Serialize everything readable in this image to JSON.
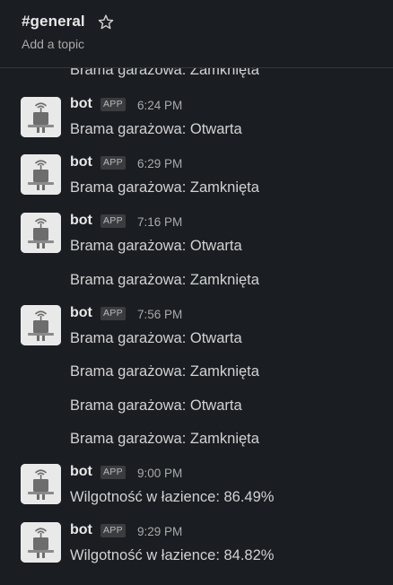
{
  "channel": {
    "name": "#general",
    "topic_placeholder": "Add a topic",
    "star_icon": "star-outline-icon"
  },
  "cut_off_text": "Brama garażowa: Zamknięta",
  "messages": [
    {
      "author": "bot",
      "badge": "APP",
      "time": "6:24 PM",
      "lines": [
        "Brama garażowa: Otwarta"
      ]
    },
    {
      "author": "bot",
      "badge": "APP",
      "time": "6:29 PM",
      "lines": [
        "Brama garażowa: Zamknięta"
      ]
    },
    {
      "author": "bot",
      "badge": "APP",
      "time": "7:16 PM",
      "lines": [
        "Brama garażowa: Otwarta",
        "Brama garażowa: Zamknięta"
      ]
    },
    {
      "author": "bot",
      "badge": "APP",
      "time": "7:56 PM",
      "lines": [
        "Brama garażowa: Otwarta",
        "Brama garażowa: Zamknięta",
        "Brama garażowa: Otwarta",
        "Brama garażowa: Zamknięta"
      ]
    },
    {
      "author": "bot",
      "badge": "APP",
      "time": "9:00 PM",
      "lines": [
        "Wilgotność w łazience: 86.49%"
      ]
    },
    {
      "author": "bot",
      "badge": "APP",
      "time": "9:29 PM",
      "lines": [
        "Wilgotność w łazience: 84.82%"
      ]
    }
  ],
  "colors": {
    "background": "#1a1d21",
    "text": "#d1d2d3",
    "muted": "#a9aaab",
    "badge_bg": "#3a3c40",
    "avatar_bg": "#e9e9e9"
  }
}
